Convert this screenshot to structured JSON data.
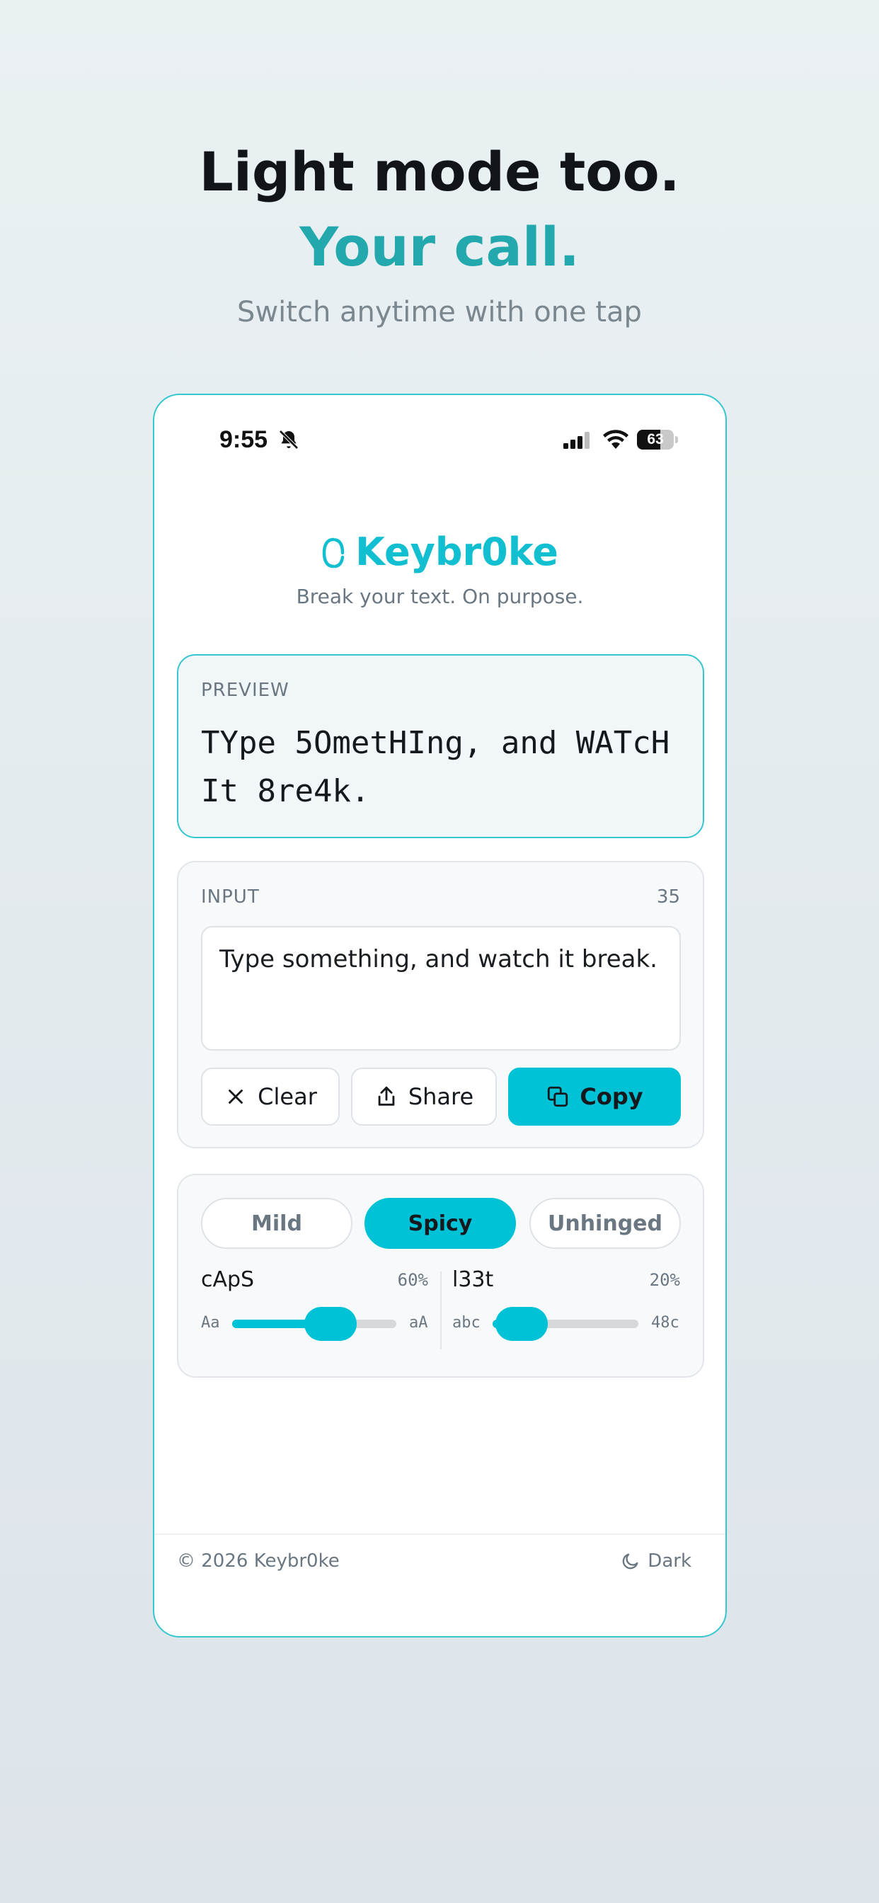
{
  "hero": {
    "title": "Light mode too.",
    "title_accent": "Your call.",
    "subtitle": "Switch anytime with one tap"
  },
  "status_bar": {
    "time": "9:55",
    "battery": "63",
    "battery_level": 0.63,
    "icons": [
      "bell-slash-icon",
      "cellular-signal-icon",
      "wifi-icon",
      "battery-icon"
    ]
  },
  "app": {
    "name": "Keybr0ke",
    "tagline": "Break your text. On purpose.",
    "brand_color": "#12bfd0"
  },
  "preview": {
    "label": "PREVIEW",
    "text": "TYpe 5OmetHIng, and WATcH It 8re4k."
  },
  "input": {
    "label": "INPUT",
    "count": "35",
    "value": "Type something, and watch it break."
  },
  "actions": {
    "clear": "Clear",
    "share": "Share",
    "copy": "Copy"
  },
  "modes": {
    "items": [
      "Mild",
      "Spicy",
      "Unhinged"
    ],
    "selected": "Spicy"
  },
  "sliders": [
    {
      "name": "cApS",
      "value_label": "60%",
      "value": 0.6,
      "min_label": "Aa",
      "max_label": "aA"
    },
    {
      "name": "l33t",
      "value_label": "20%",
      "value": 0.2,
      "min_label": "abc",
      "max_label": "48c"
    }
  ],
  "footer": {
    "copyright": "© 2026 Keybr0ke",
    "theme_toggle": "Dark"
  },
  "colors": {
    "accent": "#00c2d6",
    "hero_accent": "#22a8ad",
    "phone_border": "#35c6cf"
  }
}
